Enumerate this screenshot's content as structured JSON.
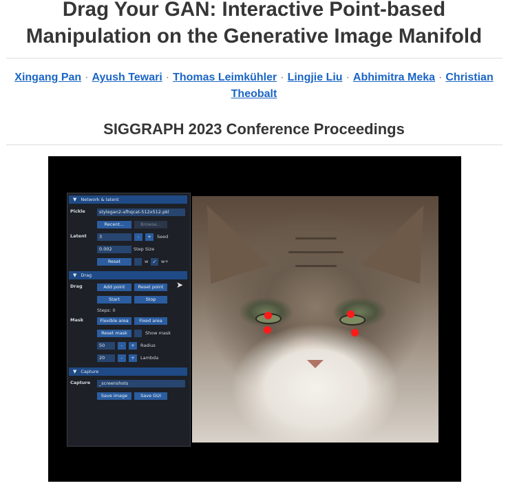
{
  "page": {
    "title_line1": "Drag Your GAN: Interactive Point-based",
    "title_line2": "Manipulation on the Generative Image Manifold",
    "authors": [
      "Xingang Pan",
      "Ayush Tewari",
      "Thomas Leimkühler",
      "Lingjie Liu",
      "Abhimitra Meka",
      "Christian Theobalt"
    ],
    "separator": "·",
    "venue": "SIGGRAPH 2023 Conference Proceedings"
  },
  "gui": {
    "network_header": "Network & latent",
    "pickle_label": "Pickle",
    "pickle_value": "stylegan2-afhqcat-512x512.pkl",
    "recent_button": "Recent...",
    "browse_button": "Browse...",
    "latent_label": "Latent",
    "latent_value": "3",
    "minus": "-",
    "plus": "+",
    "seed_label": "Seed",
    "step_value": "0.002",
    "step_label": "Step Size",
    "reset_button": "Reset",
    "w_label": "w",
    "wplus_label": "w+",
    "drag_header": "Drag",
    "drag_label": "Drag",
    "add_point_button": "Add point",
    "reset_point_button": "Reset point",
    "start_button": "Start",
    "stop_button": "Stop",
    "steps_text": "Steps: 0",
    "mask_label": "Mask",
    "flexible_area_button": "Flexible area",
    "fixed_area_button": "Fixed area",
    "reset_mask_button": "Reset mask",
    "show_mask_label": "Show mask",
    "radius_value": "50",
    "radius_label": "Radius",
    "lambda_value": "20",
    "lambda_label": "Lambda",
    "capture_header": "Capture",
    "capture_label": "Capture",
    "capture_value": "_screenshots",
    "save_image_button": "Save image",
    "save_gui_button": "Save GUI"
  },
  "icons": [
    "triangle-down-icon",
    "checkmark-icon",
    "mouse-cursor-icon"
  ],
  "colors": {
    "link": "#1a65c6",
    "handle_point": "#ff1a1a",
    "gui_header": "#1f4a86"
  }
}
